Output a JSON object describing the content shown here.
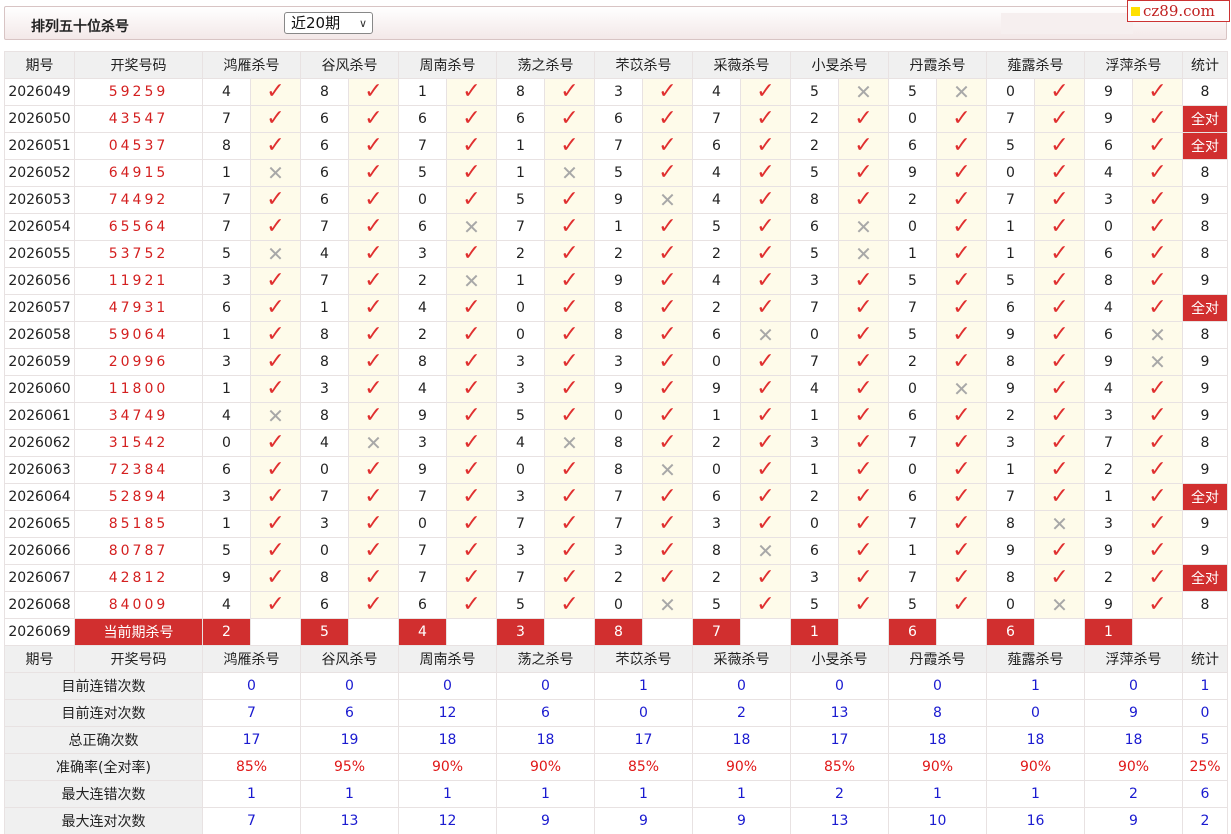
{
  "header": {
    "title": "排列五十位杀号",
    "period_select": "近20期",
    "site_logo": "cz89.com"
  },
  "columns": {
    "issue": "期号",
    "draw": "开奖号码",
    "experts": [
      "鸿雁杀号",
      "谷风杀号",
      "周南杀号",
      "荡之杀号",
      "芣苡杀号",
      "采薇杀号",
      "小旻杀号",
      "丹霞杀号",
      "薤露杀号",
      "浮萍杀号"
    ],
    "stat": "统计"
  },
  "all_right_label": "全对",
  "rows": [
    {
      "issue": "2026049",
      "draw": "59259",
      "kills": [
        "4",
        "8",
        "1",
        "8",
        "3",
        "4",
        "5",
        "5",
        "0",
        "9"
      ],
      "hits": [
        1,
        1,
        1,
        1,
        1,
        1,
        0,
        0,
        1,
        1
      ],
      "stat": "8"
    },
    {
      "issue": "2026050",
      "draw": "43547",
      "kills": [
        "7",
        "6",
        "6",
        "6",
        "6",
        "7",
        "2",
        "0",
        "7",
        "9"
      ],
      "hits": [
        1,
        1,
        1,
        1,
        1,
        1,
        1,
        1,
        1,
        1
      ],
      "stat": "全对"
    },
    {
      "issue": "2026051",
      "draw": "04537",
      "kills": [
        "8",
        "6",
        "7",
        "1",
        "7",
        "6",
        "2",
        "6",
        "5",
        "6"
      ],
      "hits": [
        1,
        1,
        1,
        1,
        1,
        1,
        1,
        1,
        1,
        1
      ],
      "stat": "全对"
    },
    {
      "issue": "2026052",
      "draw": "64915",
      "kills": [
        "1",
        "6",
        "5",
        "1",
        "5",
        "4",
        "5",
        "9",
        "0",
        "4"
      ],
      "hits": [
        0,
        1,
        1,
        0,
        1,
        1,
        1,
        1,
        1,
        1
      ],
      "stat": "8"
    },
    {
      "issue": "2026053",
      "draw": "74492",
      "kills": [
        "7",
        "6",
        "0",
        "5",
        "9",
        "4",
        "8",
        "2",
        "7",
        "3"
      ],
      "hits": [
        1,
        1,
        1,
        1,
        0,
        1,
        1,
        1,
        1,
        1
      ],
      "stat": "9"
    },
    {
      "issue": "2026054",
      "draw": "65564",
      "kills": [
        "7",
        "7",
        "6",
        "7",
        "1",
        "5",
        "6",
        "0",
        "1",
        "0"
      ],
      "hits": [
        1,
        1,
        0,
        1,
        1,
        1,
        0,
        1,
        1,
        1
      ],
      "stat": "8"
    },
    {
      "issue": "2026055",
      "draw": "53752",
      "kills": [
        "5",
        "4",
        "3",
        "2",
        "2",
        "2",
        "5",
        "1",
        "1",
        "6"
      ],
      "hits": [
        0,
        1,
        1,
        1,
        1,
        1,
        0,
        1,
        1,
        1
      ],
      "stat": "8"
    },
    {
      "issue": "2026056",
      "draw": "11921",
      "kills": [
        "3",
        "7",
        "2",
        "1",
        "9",
        "4",
        "3",
        "5",
        "5",
        "8"
      ],
      "hits": [
        1,
        1,
        0,
        1,
        1,
        1,
        1,
        1,
        1,
        1
      ],
      "stat": "9"
    },
    {
      "issue": "2026057",
      "draw": "47931",
      "kills": [
        "6",
        "1",
        "4",
        "0",
        "8",
        "2",
        "7",
        "7",
        "6",
        "4"
      ],
      "hits": [
        1,
        1,
        1,
        1,
        1,
        1,
        1,
        1,
        1,
        1
      ],
      "stat": "全对"
    },
    {
      "issue": "2026058",
      "draw": "59064",
      "kills": [
        "1",
        "8",
        "2",
        "0",
        "8",
        "6",
        "0",
        "5",
        "9",
        "6"
      ],
      "hits": [
        1,
        1,
        1,
        1,
        1,
        0,
        1,
        1,
        1,
        0
      ],
      "stat": "8"
    },
    {
      "issue": "2026059",
      "draw": "20996",
      "kills": [
        "3",
        "8",
        "8",
        "3",
        "3",
        "0",
        "7",
        "2",
        "8",
        "9"
      ],
      "hits": [
        1,
        1,
        1,
        1,
        1,
        1,
        1,
        1,
        1,
        0
      ],
      "stat": "9"
    },
    {
      "issue": "2026060",
      "draw": "11800",
      "kills": [
        "1",
        "3",
        "4",
        "3",
        "9",
        "9",
        "4",
        "0",
        "9",
        "4"
      ],
      "hits": [
        1,
        1,
        1,
        1,
        1,
        1,
        1,
        0,
        1,
        1
      ],
      "stat": "9"
    },
    {
      "issue": "2026061",
      "draw": "34749",
      "kills": [
        "4",
        "8",
        "9",
        "5",
        "0",
        "1",
        "1",
        "6",
        "2",
        "3"
      ],
      "hits": [
        0,
        1,
        1,
        1,
        1,
        1,
        1,
        1,
        1,
        1
      ],
      "stat": "9"
    },
    {
      "issue": "2026062",
      "draw": "31542",
      "kills": [
        "0",
        "4",
        "3",
        "4",
        "8",
        "2",
        "3",
        "7",
        "3",
        "7"
      ],
      "hits": [
        1,
        0,
        1,
        0,
        1,
        1,
        1,
        1,
        1,
        1
      ],
      "stat": "8"
    },
    {
      "issue": "2026063",
      "draw": "72384",
      "kills": [
        "6",
        "0",
        "9",
        "0",
        "8",
        "0",
        "1",
        "0",
        "1",
        "2"
      ],
      "hits": [
        1,
        1,
        1,
        1,
        0,
        1,
        1,
        1,
        1,
        1
      ],
      "stat": "9"
    },
    {
      "issue": "2026064",
      "draw": "52894",
      "kills": [
        "3",
        "7",
        "7",
        "3",
        "7",
        "6",
        "2",
        "6",
        "7",
        "1"
      ],
      "hits": [
        1,
        1,
        1,
        1,
        1,
        1,
        1,
        1,
        1,
        1
      ],
      "stat": "全对"
    },
    {
      "issue": "2026065",
      "draw": "85185",
      "kills": [
        "1",
        "3",
        "0",
        "7",
        "7",
        "3",
        "0",
        "7",
        "8",
        "3"
      ],
      "hits": [
        1,
        1,
        1,
        1,
        1,
        1,
        1,
        1,
        0,
        1
      ],
      "stat": "9"
    },
    {
      "issue": "2026066",
      "draw": "80787",
      "kills": [
        "5",
        "0",
        "7",
        "3",
        "3",
        "8",
        "6",
        "1",
        "9",
        "9"
      ],
      "hits": [
        1,
        1,
        1,
        1,
        1,
        0,
        1,
        1,
        1,
        1
      ],
      "stat": "9"
    },
    {
      "issue": "2026067",
      "draw": "42812",
      "kills": [
        "9",
        "8",
        "7",
        "7",
        "2",
        "2",
        "3",
        "7",
        "8",
        "2"
      ],
      "hits": [
        1,
        1,
        1,
        1,
        1,
        1,
        1,
        1,
        1,
        1
      ],
      "stat": "全对"
    },
    {
      "issue": "2026068",
      "draw": "84009",
      "kills": [
        "4",
        "6",
        "6",
        "5",
        "0",
        "5",
        "5",
        "5",
        "0",
        "9"
      ],
      "hits": [
        1,
        1,
        1,
        1,
        0,
        1,
        1,
        1,
        0,
        1
      ],
      "stat": "8"
    }
  ],
  "current": {
    "issue": "2026069",
    "label": "当前期杀号",
    "kills": [
      "2",
      "5",
      "4",
      "3",
      "8",
      "7",
      "1",
      "6",
      "6",
      "1"
    ]
  },
  "stats": [
    {
      "label": "目前连错次数",
      "values": [
        "0",
        "0",
        "0",
        "0",
        "1",
        "0",
        "0",
        "0",
        "1",
        "0"
      ],
      "total": "1",
      "color": "blue"
    },
    {
      "label": "目前连对次数",
      "values": [
        "7",
        "6",
        "12",
        "6",
        "0",
        "2",
        "13",
        "8",
        "0",
        "9"
      ],
      "total": "0",
      "color": "blue"
    },
    {
      "label": "总正确次数",
      "values": [
        "17",
        "19",
        "18",
        "18",
        "17",
        "18",
        "17",
        "18",
        "18",
        "18"
      ],
      "total": "5",
      "color": "blue"
    },
    {
      "label": "准确率(全对率)",
      "values": [
        "85%",
        "95%",
        "90%",
        "90%",
        "85%",
        "90%",
        "85%",
        "90%",
        "90%",
        "90%"
      ],
      "total": "25%",
      "color": "red"
    },
    {
      "label": "最大连错次数",
      "values": [
        "1",
        "1",
        "1",
        "1",
        "1",
        "1",
        "2",
        "1",
        "1",
        "2"
      ],
      "total": "6",
      "color": "blue"
    },
    {
      "label": "最大连对次数",
      "values": [
        "7",
        "13",
        "12",
        "9",
        "9",
        "9",
        "13",
        "10",
        "16",
        "9"
      ],
      "total": "2",
      "color": "blue"
    }
  ],
  "icons": {
    "hit": "check-icon",
    "miss": "cross-icon"
  },
  "colors": {
    "accent_red": "#d12f2f",
    "stat_blue": "#1a1ad0",
    "draw_red": "#d42020",
    "hit_bg": "#fefbea"
  }
}
